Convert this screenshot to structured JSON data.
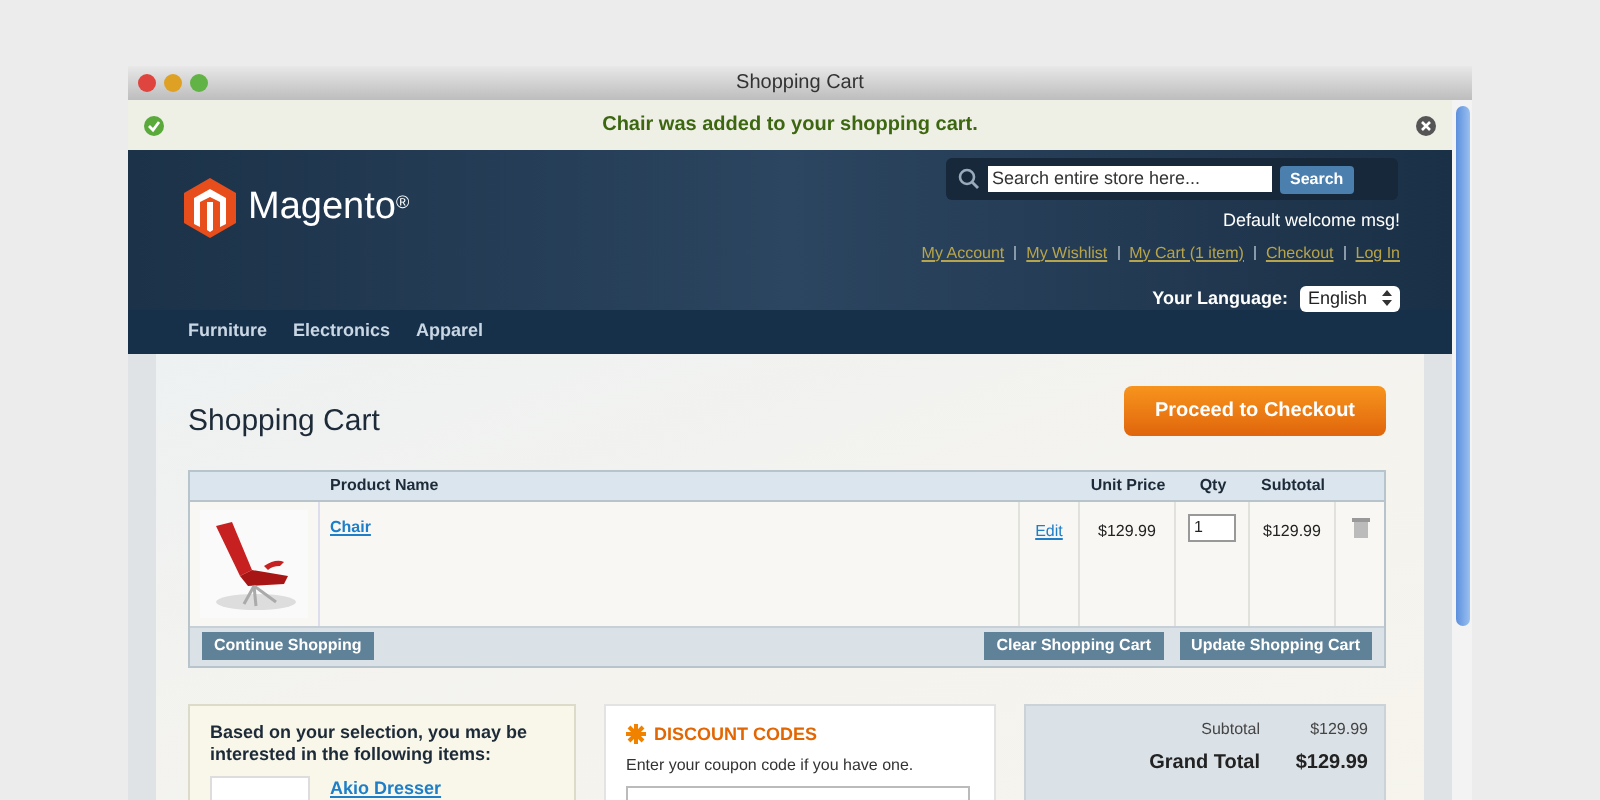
{
  "window": {
    "title": "Shopping Cart"
  },
  "notification": {
    "message": "Chair was added to your shopping cart."
  },
  "header": {
    "logo": "Magento",
    "logo_mark": "®",
    "search": {
      "placeholder": "Search entire store here...",
      "button": "Search"
    },
    "welcome": "Default welcome msg!",
    "links": [
      "My Account",
      "My Wishlist",
      "My Cart (1 item)",
      "Checkout",
      "Log In"
    ],
    "language": {
      "label": "Your Language:",
      "value": "English"
    }
  },
  "nav": [
    "Furniture",
    "Electronics",
    "Apparel"
  ],
  "cart": {
    "title": "Shopping Cart",
    "checkout_button": "Proceed to Checkout",
    "columns": {
      "product_name": "Product Name",
      "unit_price": "Unit Price",
      "qty": "Qty",
      "subtotal": "Subtotal"
    },
    "rows": [
      {
        "name": "Chair",
        "edit": "Edit",
        "unit_price": "$129.99",
        "qty": "1",
        "subtotal": "$129.99"
      }
    ],
    "continue_button": "Continue Shopping",
    "clear_button": "Clear Shopping Cart",
    "update_button": "Update Shopping Cart"
  },
  "crosssell": {
    "heading": "Based on your selection, you may be interested in the following items:",
    "items": [
      {
        "name": "Akio Dresser"
      }
    ]
  },
  "discount": {
    "heading": "DISCOUNT CODES",
    "hint": "Enter your coupon code if you have one."
  },
  "totals": [
    {
      "kind": "line",
      "label": "Subtotal",
      "value": "$129.99"
    },
    {
      "kind": "grand",
      "label": "Grand Total",
      "value": "$129.99"
    }
  ]
}
